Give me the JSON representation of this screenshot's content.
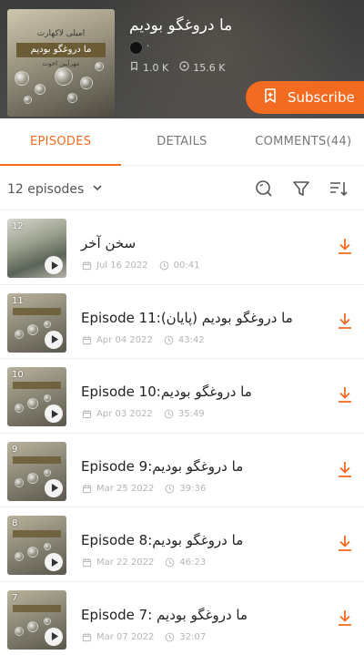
{
  "podcast": {
    "title": "ما دروغگو بودیم",
    "author_text": "·",
    "subscribers": "1.0 K",
    "plays": "15.6 K",
    "cover": {
      "small_text": "امیلی لاکهارت",
      "banner": "ما دروغگو بودیم",
      "sub_text": "مهرآیین اخوت"
    }
  },
  "subscribe": {
    "label": "Subscribe"
  },
  "tabs": [
    {
      "label": "EPISODES",
      "active": true
    },
    {
      "label": "DETAILS",
      "active": false
    },
    {
      "label": "COMMENTS(44)",
      "active": false
    }
  ],
  "toolbar": {
    "episode_count": "12 episodes"
  },
  "episodes": [
    {
      "num": "12",
      "title": "سخن آخر",
      "date": "Jul 16 2022",
      "duration": "00:41"
    },
    {
      "num": "11",
      "title": "Episode 11:ما دروغگو بودیم (پایان)",
      "date": "Apr 04 2022",
      "duration": "43:42"
    },
    {
      "num": "10",
      "title": "Episode 10:ما دروغگو بودیم",
      "date": "Apr 03 2022",
      "duration": "35:49"
    },
    {
      "num": "9",
      "title": "Episode 9:ما دروغگو بودیم",
      "date": "Mar 25 2022",
      "duration": "39:36"
    },
    {
      "num": "8",
      "title": "Episode 8:ما دروغگو بودیم",
      "date": "Mar 22 2022",
      "duration": "46:23"
    },
    {
      "num": "7",
      "title": "Episode 7: ما دروغگو بودیم",
      "date": "Mar 07 2022",
      "duration": "32:07"
    }
  ],
  "colors": {
    "accent": "#f26b21",
    "header_bg": "#444444",
    "muted": "#b5b5b5"
  }
}
